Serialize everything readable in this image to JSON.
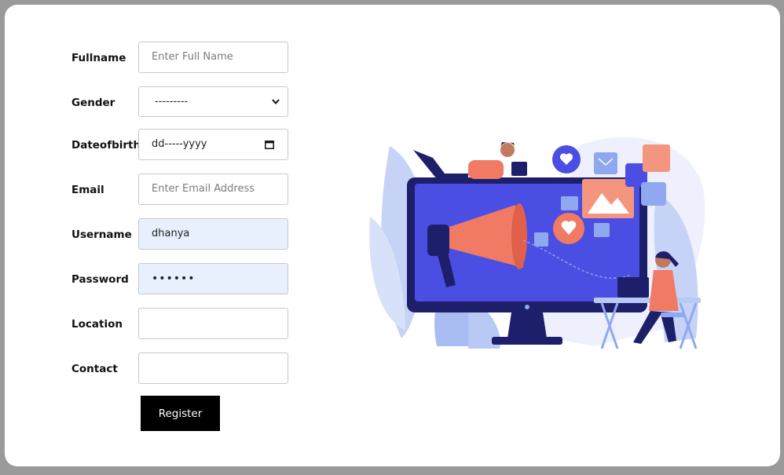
{
  "form": {
    "fullname": {
      "label": "Fullname",
      "placeholder": "Enter Full Name",
      "value": ""
    },
    "gender": {
      "label": "Gender",
      "selected": "---------"
    },
    "dob": {
      "label": "Dateofbirth",
      "value": "dd-----yyyy"
    },
    "email": {
      "label": "Email",
      "placeholder": "Enter Email Address",
      "value": ""
    },
    "username": {
      "label": "Username",
      "value": "dhanya"
    },
    "password": {
      "label": "Password",
      "value": "••••••"
    },
    "location": {
      "label": "Location",
      "value": ""
    },
    "contact": {
      "label": "Contact",
      "value": ""
    },
    "register_label": "Register"
  },
  "illustration": {
    "name": "marketing-illustration",
    "accent_colors": [
      "#4b4ee2",
      "#f07a63",
      "#8fa8f0",
      "#1e1f6b"
    ]
  }
}
